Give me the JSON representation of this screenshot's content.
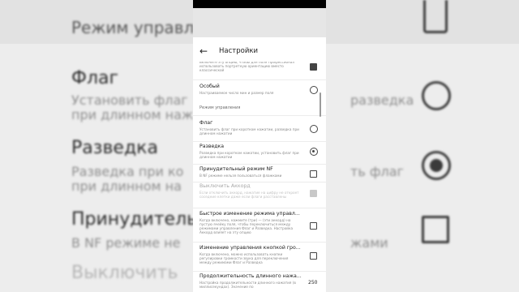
{
  "app": {
    "title": "Настройки",
    "back_icon": "arrow-left-icon"
  },
  "settings": {
    "top_partial_sub": "Включите эту опцию, чтобы для поля Профессионал использовать портретную ориентацию вместо классической",
    "custom": {
      "title": "Особый",
      "sub": "Настраиваемое число мин и размер поля"
    },
    "section_header": "Режим управления",
    "flag": {
      "title": "Флаг",
      "sub": "Установить флаг при коротком нажатии, разведка при длинном нажатии",
      "selected": false
    },
    "recon": {
      "title": "Разведка",
      "sub": "Разведка при коротком нажатии, установить флаг при длинном нажатии",
      "selected": true
    },
    "forced_nf": {
      "title": "Принудительный режим NF",
      "sub": "В NF режиме нельзя пользоваться флажками",
      "checked": false
    },
    "chord": {
      "title": "Выключить Аккорд",
      "sub": "Если отключить аккорд, нажатие на цифру не откроет соседние клетки даже если флаги расставлены",
      "checked": true,
      "disabled": true
    },
    "quick_switch": {
      "title": "Быстрое изменение режима управл...",
      "sub": "Когда включено, нажмите (три) — (эти аккорд) на пустую ячейку поля, чтобы переключиться между режимами управления Флаг и Разведка. Настройка Аккорд влияет на эту опцию",
      "checked": false
    },
    "volume_keys": {
      "title": "Изменение управления кнопкой гро...",
      "sub": "Когда включено, можно использовать кнопки регулировки громкости звука для переключения между режимами Флаг и Разведка",
      "checked": false
    },
    "long_press": {
      "title": "Продолжительность длинного нажа...",
      "sub": "Настройка продолжительности длинного нажатия (в миллисекундах). Значение по",
      "value": "250"
    }
  },
  "background": {
    "header": "Режим управле",
    "flag_title": "Флаг",
    "flag_sub_1": "Установить флаг",
    "flag_sub_2": "при длинном наж",
    "recon_title": "Разведка",
    "recon_sub_1": "Разведка при ко",
    "recon_sub_2": "при длинном на",
    "forced_title": "Принудительн",
    "forced_sub": "В NF режиме не",
    "chord_title": "Выключить",
    "right_flag_sub_1": "разведка",
    "right_forced_sub": "жами",
    "right_recon_sub": "ть флаг"
  }
}
